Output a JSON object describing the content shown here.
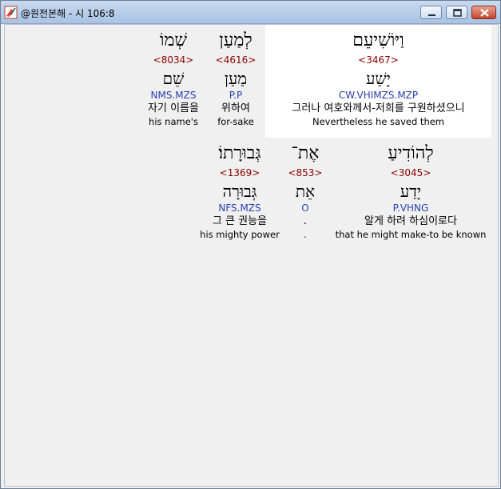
{
  "window": {
    "title": "@원전본해 - 시 106:8",
    "controls": {
      "minimize": "minimize",
      "maximize": "maximize",
      "close": "close"
    }
  },
  "row1": [
    {
      "hebrew": "שְׁמוֹ",
      "strongs": "<8034>",
      "lemma": "שֵׁם",
      "parse": "NMS.MZS",
      "korean": "자기 이름을",
      "english": "his name's"
    },
    {
      "hebrew": "לְמַעַן",
      "strongs": "<4616>",
      "lemma": "מַעַן",
      "parse": "P.P",
      "korean": "위하여",
      "english": "for-sake"
    },
    {
      "hebrew": "וַיּוֹשִׁיעֵם",
      "strongs": "<3467>",
      "lemma": "יָשַׁע",
      "parse": "CW.VHIMZS.MZP",
      "korean": "그러나 여호와께서-저희를 구원하셨으니",
      "english": "Nevertheless he saved them"
    }
  ],
  "row2": [
    {
      "hebrew": "גְּבוּרָתוֹ׃",
      "strongs": "<1369>",
      "lemma": "גְּבוּרָה",
      "parse": "NFS.MZS",
      "korean": "그 큰 권능을",
      "english": "his mighty power"
    },
    {
      "hebrew": "אֶת־",
      "strongs": "<853>",
      "lemma": "אֵת",
      "parse": "O",
      "korean": ".",
      "english": "."
    },
    {
      "hebrew": "לְהוֹדִיעַ",
      "strongs": "<3045>",
      "lemma": "יָדַע",
      "parse": "P.VHNG",
      "korean": "알게 하려 하심이로다",
      "english": "that he might make-to be known"
    }
  ],
  "colors": {
    "strongs": "#8b0000",
    "parse": "#2a3fb0",
    "highlight": "#ffffff",
    "background": "#f0f0f0"
  }
}
